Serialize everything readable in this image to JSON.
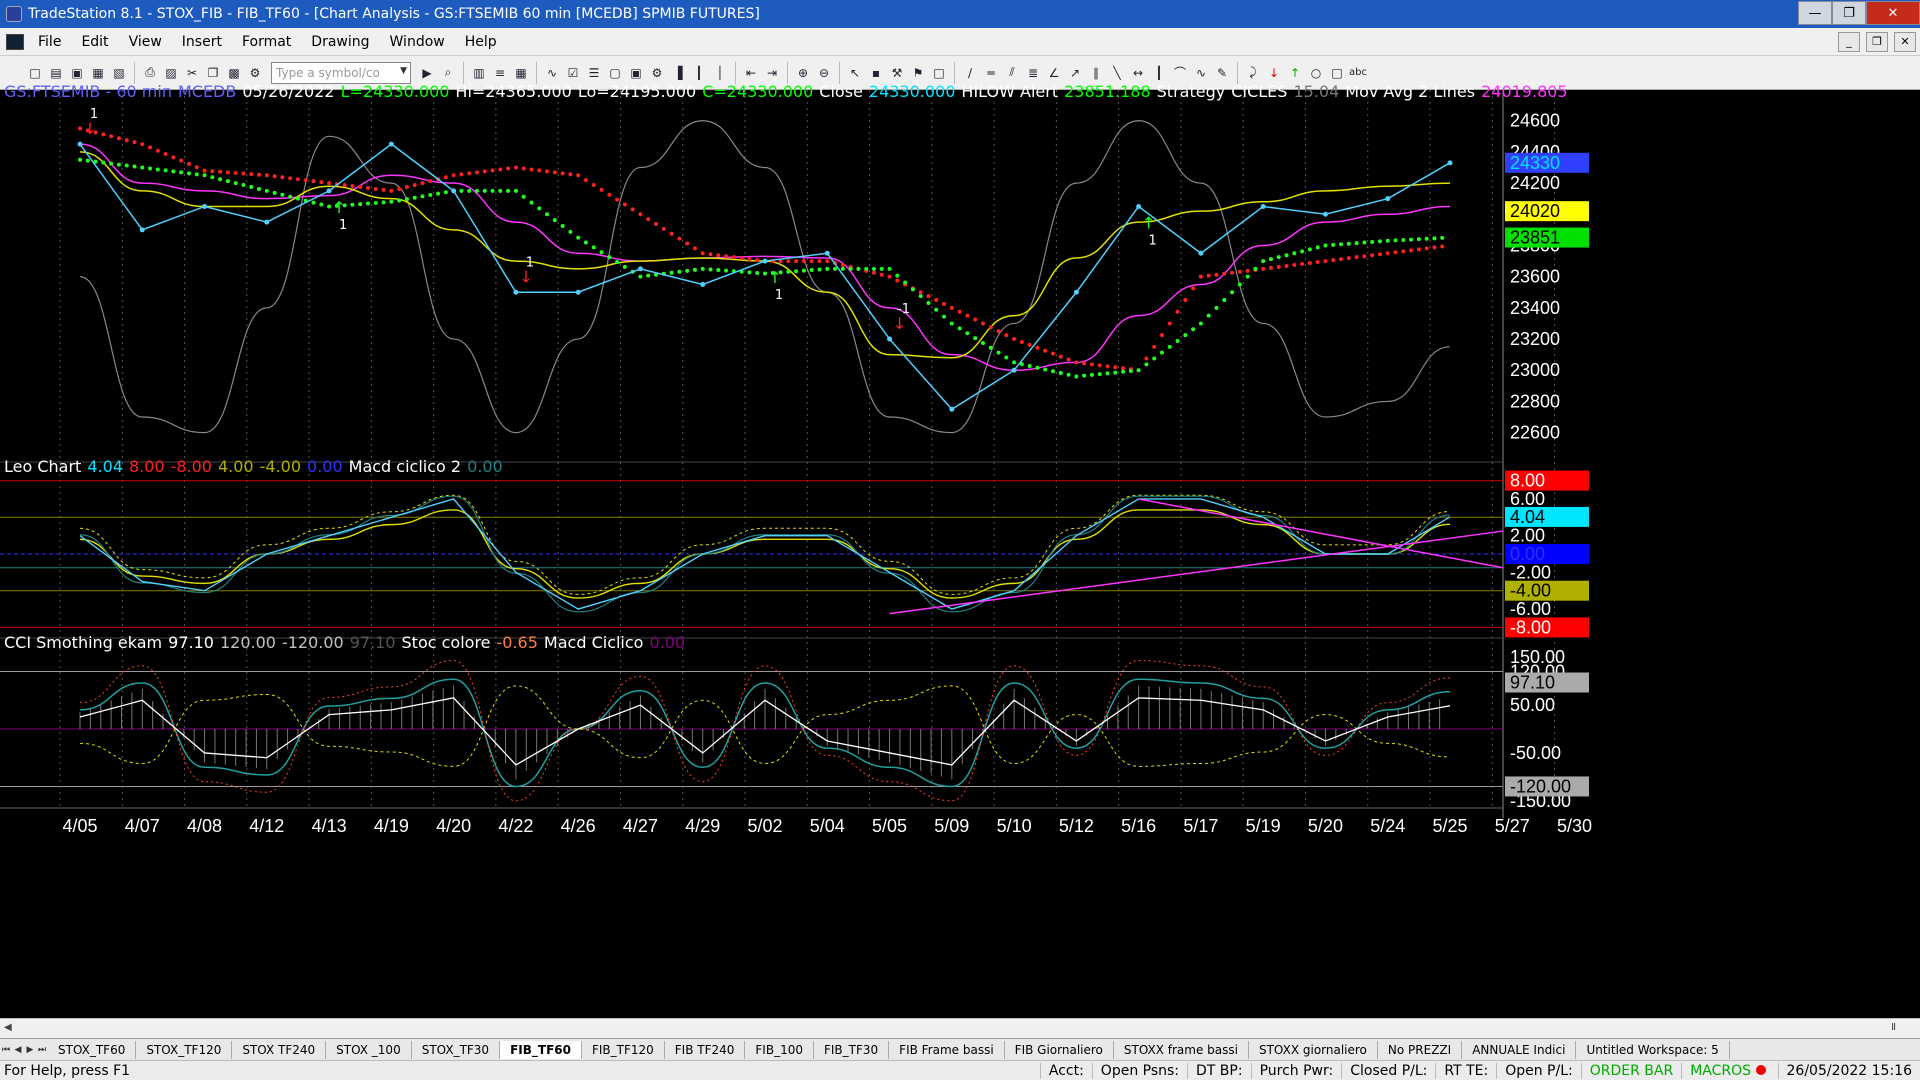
{
  "window": {
    "title": "TradeStation 8.1 - STOX_FIB - FIB_TF60 - [Chart Analysis - GS:FTSEMIB  60 min  [MCEDB] SPMIB FUTURES]",
    "minimize": "—",
    "maximize": "❐",
    "close": "✕"
  },
  "menu": [
    "File",
    "Edit",
    "View",
    "Insert",
    "Format",
    "Drawing",
    "Window",
    "Help"
  ],
  "toolbar": {
    "symbol_placeholder": "Type a symbol/co"
  },
  "readouts": {
    "main": [
      {
        "text": "GS:FTSEMIB - 60 min",
        "color": "#5f5fff"
      },
      {
        "text": "MCEDB",
        "color": "#5f5fff"
      },
      {
        "text": "05/26/2022",
        "color": "#ffffff"
      },
      {
        "text": "L=24330.000",
        "color": "#00ff00"
      },
      {
        "text": "Hi=24365.000",
        "color": "#ffffff"
      },
      {
        "text": "Lo=24195.000",
        "color": "#ffffff"
      },
      {
        "text": "C=24330.000",
        "color": "#00ff00"
      },
      {
        "text": "Close",
        "color": "#ffffff"
      },
      {
        "text": "24330.000",
        "color": "#00e5ff"
      },
      {
        "text": "HILOW Alert",
        "color": "#ffffff"
      },
      {
        "text": "23851.188",
        "color": "#00ff00"
      },
      {
        "text": "Strategy",
        "color": "#ffffff"
      },
      {
        "text": "CICLES",
        "color": "#ffffff"
      },
      {
        "text": "15.04",
        "color": "#777777"
      },
      {
        "text": "Mov Avg 2 Lines",
        "color": "#ffffff"
      },
      {
        "text": "24019.805",
        "color": "#ff33ff"
      }
    ],
    "leo": [
      {
        "text": "Leo Chart",
        "color": "#ffffff"
      },
      {
        "text": "4.04",
        "color": "#00e5ff"
      },
      {
        "text": "8.00",
        "color": "#ff2020"
      },
      {
        "text": "-8.00",
        "color": "#ff2020"
      },
      {
        "text": "4.00",
        "color": "#b0b000"
      },
      {
        "text": "-4.00",
        "color": "#b0b000"
      },
      {
        "text": "0.00",
        "color": "#3030ff"
      },
      {
        "text": "Macd ciclico 2",
        "color": "#ffffff"
      },
      {
        "text": "0.00",
        "color": "#208080"
      }
    ],
    "cci": [
      {
        "text": "CCI Smothing ekam",
        "color": "#ffffff"
      },
      {
        "text": "97.10",
        "color": "#ffffff"
      },
      {
        "text": "120.00",
        "color": "#c0c0c0"
      },
      {
        "text": "-120.00",
        "color": "#c0c0c0"
      },
      {
        "text": "97.10",
        "color": "#555555"
      },
      {
        "text": "Stoc colore",
        "color": "#ffffff"
      },
      {
        "text": "-0.65",
        "color": "#ff8040"
      },
      {
        "text": "Macd Ciclico",
        "color": "#ffffff"
      },
      {
        "text": "0.00",
        "color": "#800080"
      }
    ]
  },
  "axes": {
    "main": {
      "ticks": [
        "24600",
        "24400",
        "24200",
        "24000",
        "23800",
        "23600",
        "23400",
        "23200",
        "23000",
        "22800",
        "22600"
      ],
      "badges": [
        {
          "text": "24330",
          "value": 24330,
          "bg": "#3040ff",
          "fg": "#00e5ff"
        },
        {
          "text": "24020",
          "value": 24020,
          "bg": "#ffff00",
          "fg": "#000000"
        },
        {
          "text": "23851",
          "value": 23851,
          "bg": "#00e000",
          "fg": "#000000"
        }
      ]
    },
    "leo": {
      "ticks": [
        "6.00",
        "2.00",
        "-2.00",
        "-6.00"
      ],
      "badges": [
        {
          "text": "8.00",
          "value": 8,
          "bg": "#ff0000",
          "fg": "#ffffff"
        },
        {
          "text": "4.04",
          "value": 4.04,
          "bg": "#00e5ff",
          "fg": "#000000"
        },
        {
          "text": "0.00",
          "value": 0,
          "bg": "#0000ff",
          "fg": "#3030ff"
        },
        {
          "text": "-4.00",
          "value": -4,
          "bg": "#b0b000",
          "fg": "#000000"
        },
        {
          "text": "-8.00",
          "value": -8,
          "bg": "#ff0000",
          "fg": "#ffffff"
        }
      ]
    },
    "cci": {
      "ticks": [
        "150.00",
        "120.00",
        "50.00",
        "-50.00",
        "-150.00"
      ],
      "badges": [
        {
          "text": "97.10",
          "value": 97.1,
          "bg": "#aaaaaa",
          "fg": "#000000"
        },
        {
          "text": "-120.00",
          "value": -120,
          "bg": "#aaaaaa",
          "fg": "#000000"
        }
      ]
    }
  },
  "chart_data": {
    "type": "line",
    "x": [
      "4/05",
      "4/07",
      "4/08",
      "4/12",
      "4/13",
      "4/19",
      "4/20",
      "4/22",
      "4/26",
      "4/27",
      "4/29",
      "5/02",
      "5/04",
      "5/05",
      "5/09",
      "5/10",
      "5/12",
      "5/16",
      "5/17",
      "5/19",
      "5/20",
      "5/24",
      "5/25",
      "5/27",
      "5/30"
    ],
    "price": {
      "close": [
        24450,
        23900,
        24050,
        23950,
        24150,
        24450,
        24150,
        23500,
        23500,
        23650,
        23550,
        23700,
        23750,
        23200,
        22750,
        23000,
        23500,
        24050,
        23750,
        24050,
        24000,
        24100,
        24330
      ],
      "mov_avg_fast": [
        24400,
        24150,
        24050,
        24050,
        24180,
        24100,
        23900,
        23700,
        23650,
        23700,
        23720,
        23700,
        23500,
        23100,
        23080,
        23350,
        23720,
        23950,
        24020,
        24080,
        24150,
        24180,
        24200
      ],
      "mov_avg_slow": [
        24450,
        24200,
        24150,
        24100,
        24120,
        24250,
        24200,
        23950,
        23750,
        23700,
        23720,
        23730,
        23720,
        23400,
        23100,
        23000,
        23050,
        23350,
        23550,
        23800,
        23950,
        24000,
        24050
      ],
      "hilow_red": [
        24550,
        24450,
        24280,
        24250,
        24200,
        24150,
        24250,
        24300,
        24250,
        24000,
        23750,
        23700,
        23700,
        23600,
        23400,
        23200,
        23050,
        23000,
        23600,
        23650,
        23700,
        23750,
        23800
      ],
      "hilow_green": [
        24350,
        24300,
        24250,
        24150,
        24050,
        24080,
        24150,
        24150,
        23850,
        23600,
        23650,
        23620,
        23650,
        23650,
        23300,
        23050,
        22960,
        23000,
        23300,
        23700,
        23800,
        23830,
        23851
      ],
      "cycle_sine": [
        23600,
        22700,
        22600,
        23400,
        24500,
        24200,
        23200,
        22600,
        23200,
        24300,
        24600,
        24300,
        23500,
        22700,
        22600,
        23300,
        24200,
        24600,
        24200,
        23300,
        22700,
        22800,
        23150
      ],
      "signals": [
        {
          "at": "4/05",
          "label": "1",
          "dir": "down"
        },
        {
          "at": "4/13",
          "label": "1",
          "dir": "up"
        },
        {
          "at": "4/22",
          "label": "1",
          "dir": "down"
        },
        {
          "at": "5/02",
          "label": "1",
          "dir": "up"
        },
        {
          "at": "5/05",
          "label": "-1",
          "dir": "down"
        },
        {
          "at": "5/16",
          "label": "1",
          "dir": "up"
        }
      ]
    },
    "leo": [
      2,
      -3,
      -4,
      0,
      2,
      4,
      6,
      -2,
      -6,
      -4,
      0,
      2,
      2,
      -2,
      -6,
      -4,
      2,
      6,
      6,
      4,
      0,
      0,
      4.04
    ],
    "cci": [
      50,
      120,
      -100,
      -120,
      60,
      80,
      130,
      -150,
      0,
      100,
      -100,
      120,
      -50,
      -100,
      -150,
      120,
      -50,
      130,
      120,
      80,
      -50,
      50,
      97.1
    ],
    "ylim_main": [
      22450,
      24720
    ],
    "ylim_leo": [
      -8.5,
      8.5
    ],
    "ylim_cci": [
      -165,
      165
    ]
  },
  "tabs": [
    "STOX_TF60",
    "STOX_TF120",
    "STOX TF240",
    "STOX _100",
    "STOX_TF30",
    "FIB_TF60",
    "FIB_TF120",
    "FIB TF240",
    "FIB_100",
    "FIB_TF30",
    "FIB Frame bassi",
    "FIB Giornaliero",
    "STOXX frame bassi",
    "STOXX giornaliero",
    "No PREZZI",
    "ANNUALE Indici",
    "Untitled Workspace: 5"
  ],
  "active_tab": "FIB_TF60",
  "status": {
    "help": "For Help, press F1",
    "cells": [
      "Acct:",
      "Open Psns:",
      "DT BP:",
      "Purch Pwr:",
      "Closed P/L:",
      "RT TE:",
      "Open P/L:"
    ],
    "orderbar": "ORDER BAR",
    "macros": "MACROS",
    "datetime": "26/05/2022 15:16"
  }
}
